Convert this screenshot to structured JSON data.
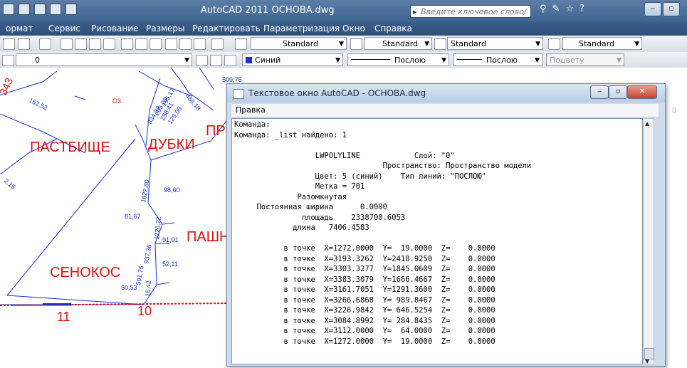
{
  "app": {
    "title": "AutoCAD 2011   OCHOBA.dwg",
    "search_placeholder": "Введите ключевое слово/фразу"
  },
  "menubar": [
    "ормат",
    "Сервис",
    "Рисование",
    "Размеры",
    "Редактировать",
    "Параметризация",
    "Окно",
    "Справка"
  ],
  "toolbar": {
    "style1": "Standard",
    "style2": "Standard",
    "style3": "Standard",
    "style4": "Standard",
    "layer": "0",
    "color": "Синий",
    "linetype1": "Послою",
    "linetype2": "Послою",
    "plotstyle": "Поцвету"
  },
  "drawing": {
    "labels": {
      "pastbishche": "ПАСТБИЩЕ",
      "dubki": "ДУБКИ",
      "pr": "ПР",
      "pashn": "ПАШН",
      "senokos": "СЕНОКОС",
      "n11": "11",
      "n10": "10",
      "o3": "O3."
    },
    "dims": [
      "152,52",
      "98,60",
      "1622,80",
      "81,67",
      "1226,22",
      "91,91",
      "937,36",
      "52,11",
      "591,75",
      "50,53",
      "16,42",
      "334,32",
      "205,23",
      "195,17",
      "298,41",
      "129,05",
      "466,18",
      "509,75",
      "343",
      "2,15"
    ]
  },
  "text_window": {
    "title": "Текстовое окно AutoCAD - OCHOBA.dwg",
    "menu": "Правка",
    "lines": [
      "Команда:",
      "Команда: _list найдено: 1",
      "",
      "                  LWPOLYLINE            Слой: \"0\"",
      "                                 Пространство: Пространство модели",
      "                  Цвет: 5 (синий)    Тип линий: \"ПОСЛОЮ\"",
      "                  Метка = 701",
      "              Разомкнутая",
      "     Постоянная ширина      0.0000",
      "               площадь    2338700.6053",
      "             длина   7406.4583",
      "",
      "           в точке  X=1272.0000  Y=  19.0000  Z=    0.0000",
      "           в точке  X=3193.3262  Y=2418.9250  Z=    0.0000",
      "           в точке  X=3303.3277  Y=1845.0609  Z=    0.0000",
      "           в точке  X=3383.3079  Y=1666.4667  Z=    0.0000",
      "           в точке  X=3161.7051  Y=1291.3600  Z=    0.0000",
      "           в точке  X=3266.6868  Y= 989.8467  Z=    0.0000",
      "           в точке  X=3226.9842  Y= 646.5254  Z=    0.0000",
      "           в точке  X=3084.8992  Y= 284.8435  Z=    0.0000",
      "           в точке  X=3112.0000  Y=  64.0000  Z=    0.0000",
      "           в точке  X=1272.0000  Y=  19.0000  Z=    0.0000"
    ]
  },
  "colors": {
    "accent": "#3e6591",
    "drawing_red": "#e01010",
    "drawing_blue": "#1a2fd6"
  }
}
